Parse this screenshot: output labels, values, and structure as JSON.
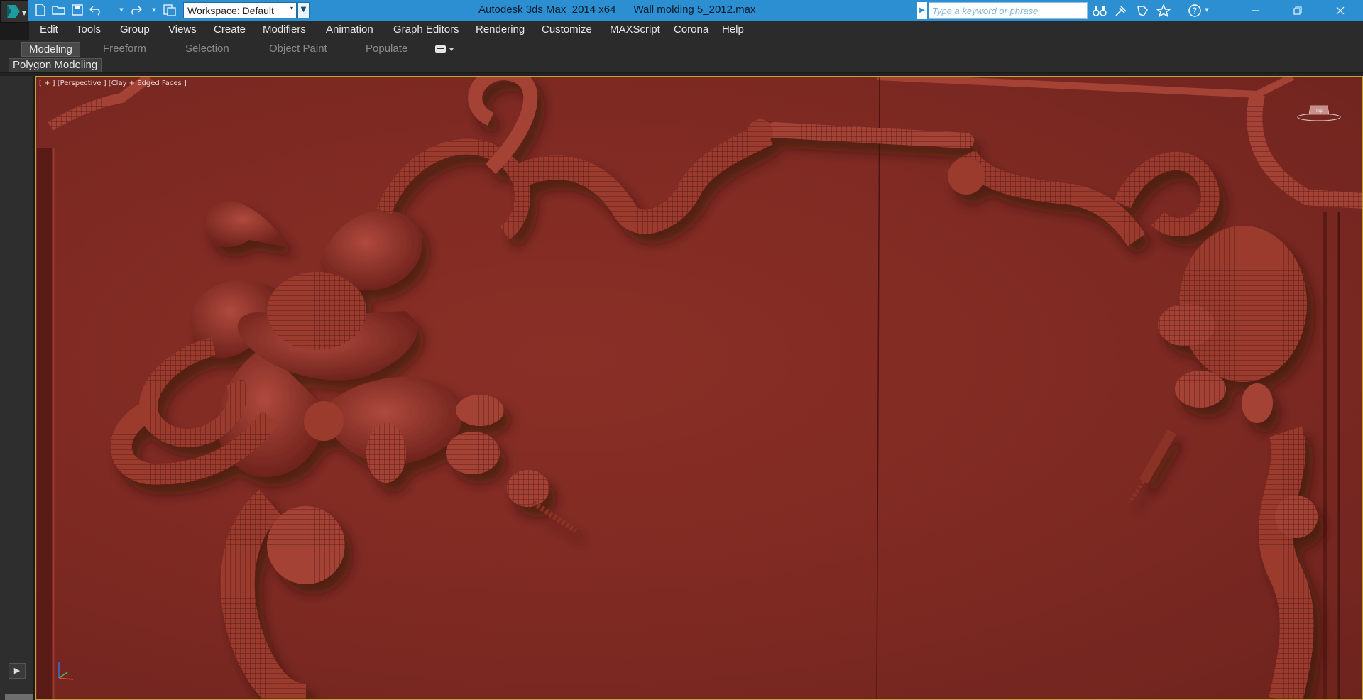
{
  "titlebar": {
    "workspace_label": "Workspace: Default",
    "app_title": "Autodesk 3ds Max  2014 x64      Wall molding 5_2012.max",
    "search_placeholder": "Type a keyword or phrase",
    "quick_access_icons": [
      "new-file-icon",
      "open-folder-icon",
      "save-icon",
      "undo-icon",
      "redo-icon",
      "project-folder-icon"
    ],
    "tool_icons": [
      "binoculars-icon",
      "subscription-center-icon",
      "communication-center-icon",
      "favorites-star-icon",
      "help-icon"
    ],
    "window_controls": [
      "minimize-icon",
      "restore-icon",
      "close-icon"
    ],
    "accent_color": "#2b8fd2"
  },
  "menu": {
    "items": [
      "Edit",
      "Tools",
      "Group",
      "Views",
      "Create",
      "Modifiers",
      "Animation",
      "Graph Editors",
      "Rendering",
      "Customize",
      "MAXScript",
      "Corona",
      "Help"
    ]
  },
  "ribbon": {
    "tabs": [
      "Modeling",
      "Freeform",
      "Selection",
      "Object Paint",
      "Populate"
    ],
    "active_tab": "Modeling",
    "panel_label": "Polygon Modeling"
  },
  "viewport": {
    "label": "[ + ] [Perspective ] [Clay + Edged Faces ]",
    "viewcube_label": "Top",
    "background_color": "#7c2922",
    "frame_color": "#c2a43c"
  }
}
